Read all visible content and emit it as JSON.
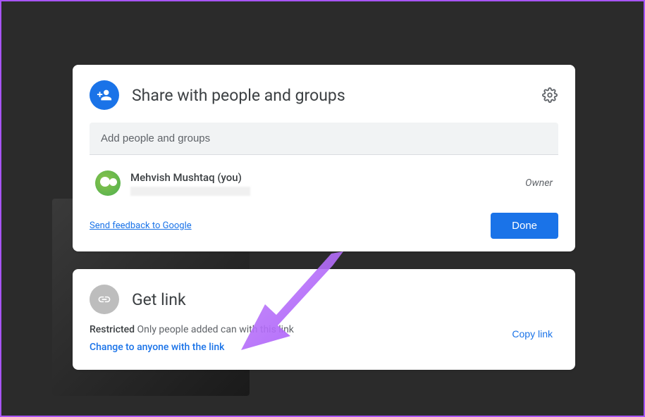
{
  "share": {
    "title": "Share with people and groups",
    "input_placeholder": "Add people and groups",
    "person": {
      "name": "Mehvish Mushtaq (you)",
      "role": "Owner"
    },
    "feedback_label": "Send feedback to Google",
    "done_label": "Done"
  },
  "link": {
    "title": "Get link",
    "restricted_label": "Restricted",
    "restricted_desc": "Only people added can          with this link",
    "change_label": "Change to anyone with the link",
    "copy_label": "Copy link"
  },
  "icons": {
    "person_add": "person-add-icon",
    "gear": "gear-icon",
    "link": "link-icon"
  }
}
